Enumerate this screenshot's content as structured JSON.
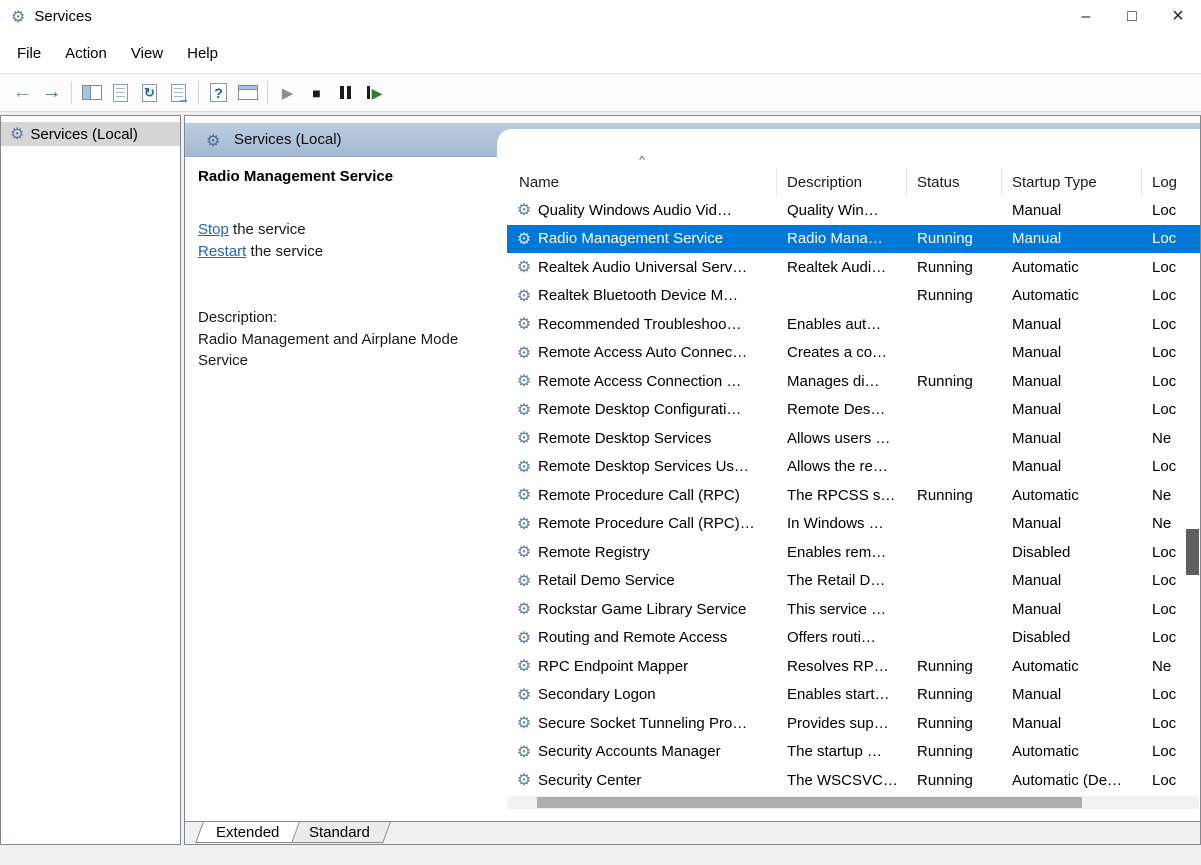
{
  "window": {
    "title": "Services"
  },
  "icons": {
    "app_gear": "⚙",
    "minimize": "–",
    "maximize": "□",
    "close": "×",
    "back_arrow": "←",
    "forward_arrow": "→",
    "refresh": "↻",
    "export_arrow": "→",
    "help_mark": "?",
    "play": "▶",
    "stop": "■",
    "restart_play": "▶",
    "gear": "⚙",
    "sort_asc": "^"
  },
  "menu": {
    "items": [
      "File",
      "Action",
      "View",
      "Help"
    ]
  },
  "toolbar": {
    "buttons": [
      "back",
      "forward",
      "show-console-tree",
      "properties",
      "refresh",
      "export-list",
      "help",
      "customize-view",
      "start-service",
      "stop-service",
      "pause-service",
      "restart-service"
    ]
  },
  "tree": {
    "root_label": "Services (Local)"
  },
  "pane": {
    "header": "Services (Local)",
    "extended": {
      "service_name": "Radio Management Service",
      "stop_link": "Stop",
      "stop_rest": " the service",
      "restart_link": "Restart",
      "restart_rest": " the service",
      "description_label": "Description:",
      "description_text": "Radio Management and Airplane Mode Service"
    },
    "table": {
      "columns": [
        "Name",
        "Description",
        "Status",
        "Startup Type",
        "Log"
      ],
      "rows": [
        {
          "name": "Quality Windows Audio Vid…",
          "description": "Quality Win…",
          "status": "",
          "startup": "Manual",
          "logon": "Loc"
        },
        {
          "name": "Radio Management Service",
          "description": "Radio Mana…",
          "status": "Running",
          "startup": "Manual",
          "logon": "Loc",
          "selected": true
        },
        {
          "name": "Realtek Audio Universal Serv…",
          "description": "Realtek Audi…",
          "status": "Running",
          "startup": "Automatic",
          "logon": "Loc"
        },
        {
          "name": "Realtek Bluetooth Device M…",
          "description": "",
          "status": "Running",
          "startup": "Automatic",
          "logon": "Loc"
        },
        {
          "name": "Recommended Troubleshoo…",
          "description": "Enables aut…",
          "status": "",
          "startup": "Manual",
          "logon": "Loc"
        },
        {
          "name": "Remote Access Auto Connec…",
          "description": "Creates a co…",
          "status": "",
          "startup": "Manual",
          "logon": "Loc"
        },
        {
          "name": "Remote Access Connection …",
          "description": "Manages di…",
          "status": "Running",
          "startup": "Manual",
          "logon": "Loc"
        },
        {
          "name": "Remote Desktop Configurati…",
          "description": "Remote Des…",
          "status": "",
          "startup": "Manual",
          "logon": "Loc"
        },
        {
          "name": "Remote Desktop Services",
          "description": "Allows users …",
          "status": "",
          "startup": "Manual",
          "logon": "Ne"
        },
        {
          "name": "Remote Desktop Services Us…",
          "description": "Allows the re…",
          "status": "",
          "startup": "Manual",
          "logon": "Loc"
        },
        {
          "name": "Remote Procedure Call (RPC)",
          "description": "The RPCSS s…",
          "status": "Running",
          "startup": "Automatic",
          "logon": "Ne"
        },
        {
          "name": "Remote Procedure Call (RPC)…",
          "description": "In Windows …",
          "status": "",
          "startup": "Manual",
          "logon": "Ne"
        },
        {
          "name": "Remote Registry",
          "description": "Enables rem…",
          "status": "",
          "startup": "Disabled",
          "logon": "Loc"
        },
        {
          "name": "Retail Demo Service",
          "description": "The Retail D…",
          "status": "",
          "startup": "Manual",
          "logon": "Loc"
        },
        {
          "name": "Rockstar Game Library Service",
          "description": "This service …",
          "status": "",
          "startup": "Manual",
          "logon": "Loc"
        },
        {
          "name": "Routing and Remote Access",
          "description": "Offers routi…",
          "status": "",
          "startup": "Disabled",
          "logon": "Loc"
        },
        {
          "name": "RPC Endpoint Mapper",
          "description": "Resolves RP…",
          "status": "Running",
          "startup": "Automatic",
          "logon": "Ne"
        },
        {
          "name": "Secondary Logon",
          "description": "Enables start…",
          "status": "Running",
          "startup": "Manual",
          "logon": "Loc"
        },
        {
          "name": "Secure Socket Tunneling Pro…",
          "description": "Provides sup…",
          "status": "Running",
          "startup": "Manual",
          "logon": "Loc"
        },
        {
          "name": "Security Accounts Manager",
          "description": "The startup …",
          "status": "Running",
          "startup": "Automatic",
          "logon": "Loc"
        },
        {
          "name": "Security Center",
          "description": "The WSCSVC…",
          "status": "Running",
          "startup": "Automatic (De…",
          "logon": "Loc"
        }
      ]
    },
    "tabs": [
      "Extended",
      "Standard"
    ]
  },
  "colors": {
    "selection": "#0078d7",
    "link": "#2962b8",
    "band_top": "#bccde0",
    "band_bottom": "#a4b9d2"
  }
}
